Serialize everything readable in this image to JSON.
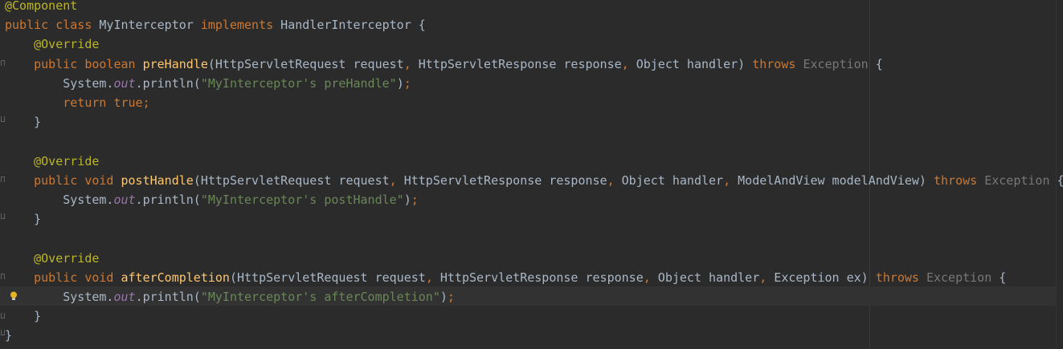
{
  "editor": {
    "colors": {
      "background": "#2b2b2b",
      "keyword": "#cc7832",
      "annotation": "#bbb529",
      "method": "#ffc66d",
      "string": "#6a8759",
      "static_field": "#9876aa",
      "plain": "#a9b7c6",
      "dim": "#787878"
    },
    "gutter_icons": [
      "fold-icon",
      "lightbulb-icon"
    ],
    "lines": [
      {
        "tokens": [
          {
            "t": "@Component",
            "c": "ann"
          }
        ]
      },
      {
        "tokens": [
          {
            "t": "public",
            "c": "kw"
          },
          {
            "t": " ",
            "c": "pl"
          },
          {
            "t": "class",
            "c": "kw"
          },
          {
            "t": " MyInterceptor ",
            "c": "pl"
          },
          {
            "t": "implements",
            "c": "kw"
          },
          {
            "t": " HandlerInterceptor {",
            "c": "pl"
          }
        ]
      },
      {
        "tokens": [
          {
            "t": "    ",
            "c": "pl"
          },
          {
            "t": "@Override",
            "c": "ann"
          }
        ]
      },
      {
        "tokens": [
          {
            "t": "    ",
            "c": "pl"
          },
          {
            "t": "public",
            "c": "kw"
          },
          {
            "t": " ",
            "c": "pl"
          },
          {
            "t": "boolean",
            "c": "kw"
          },
          {
            "t": " ",
            "c": "pl"
          },
          {
            "t": "preHandle",
            "c": "fn"
          },
          {
            "t": "(HttpServletRequest request",
            "c": "pl"
          },
          {
            "t": ",",
            "c": "kw"
          },
          {
            "t": " HttpServletResponse response",
            "c": "pl"
          },
          {
            "t": ",",
            "c": "kw"
          },
          {
            "t": " Object handler) ",
            "c": "pl"
          },
          {
            "t": "throws",
            "c": "kw"
          },
          {
            "t": " ",
            "c": "pl"
          },
          {
            "t": "Exception",
            "c": "exc"
          },
          {
            "t": " {",
            "c": "pl"
          }
        ]
      },
      {
        "tokens": [
          {
            "t": "        System.",
            "c": "pl"
          },
          {
            "t": "out",
            "c": "ital"
          },
          {
            "t": ".println(",
            "c": "pl"
          },
          {
            "t": "\"MyInterceptor's preHandle\"",
            "c": "str"
          },
          {
            "t": ")",
            "c": "pl"
          },
          {
            "t": ";",
            "c": "kw"
          }
        ]
      },
      {
        "tokens": [
          {
            "t": "        ",
            "c": "pl"
          },
          {
            "t": "return",
            "c": "kw"
          },
          {
            "t": " ",
            "c": "pl"
          },
          {
            "t": "true",
            "c": "kw"
          },
          {
            "t": ";",
            "c": "kw"
          }
        ]
      },
      {
        "tokens": [
          {
            "t": "    }",
            "c": "pl"
          }
        ]
      },
      {
        "tokens": []
      },
      {
        "tokens": [
          {
            "t": "    ",
            "c": "pl"
          },
          {
            "t": "@Override",
            "c": "ann"
          }
        ]
      },
      {
        "tokens": [
          {
            "t": "    ",
            "c": "pl"
          },
          {
            "t": "public",
            "c": "kw"
          },
          {
            "t": " ",
            "c": "pl"
          },
          {
            "t": "void",
            "c": "kw"
          },
          {
            "t": " ",
            "c": "pl"
          },
          {
            "t": "postHandle",
            "c": "fn"
          },
          {
            "t": "(HttpServletRequest request",
            "c": "pl"
          },
          {
            "t": ",",
            "c": "kw"
          },
          {
            "t": " HttpServletResponse response",
            "c": "pl"
          },
          {
            "t": ",",
            "c": "kw"
          },
          {
            "t": " Object handler",
            "c": "pl"
          },
          {
            "t": ",",
            "c": "kw"
          },
          {
            "t": " ModelAndView modelAndView) ",
            "c": "pl"
          },
          {
            "t": "throws",
            "c": "kw"
          },
          {
            "t": " ",
            "c": "pl"
          },
          {
            "t": "Exception",
            "c": "exc"
          },
          {
            "t": " {",
            "c": "pl"
          }
        ]
      },
      {
        "tokens": [
          {
            "t": "        System.",
            "c": "pl"
          },
          {
            "t": "out",
            "c": "ital"
          },
          {
            "t": ".println(",
            "c": "pl"
          },
          {
            "t": "\"MyInterceptor's postHandle\"",
            "c": "str"
          },
          {
            "t": ")",
            "c": "pl"
          },
          {
            "t": ";",
            "c": "kw"
          }
        ]
      },
      {
        "tokens": [
          {
            "t": "    }",
            "c": "pl"
          }
        ]
      },
      {
        "tokens": []
      },
      {
        "tokens": [
          {
            "t": "    ",
            "c": "pl"
          },
          {
            "t": "@Override",
            "c": "ann"
          }
        ]
      },
      {
        "tokens": [
          {
            "t": "    ",
            "c": "pl"
          },
          {
            "t": "public",
            "c": "kw"
          },
          {
            "t": " ",
            "c": "pl"
          },
          {
            "t": "void",
            "c": "kw"
          },
          {
            "t": " ",
            "c": "pl"
          },
          {
            "t": "afterCompletion",
            "c": "fn"
          },
          {
            "t": "(HttpServletRequest request",
            "c": "pl"
          },
          {
            "t": ",",
            "c": "kw"
          },
          {
            "t": " HttpServletResponse response",
            "c": "pl"
          },
          {
            "t": ",",
            "c": "kw"
          },
          {
            "t": " Object handler",
            "c": "pl"
          },
          {
            "t": ",",
            "c": "kw"
          },
          {
            "t": " Exception ex) ",
            "c": "pl"
          },
          {
            "t": "throws",
            "c": "kw"
          },
          {
            "t": " ",
            "c": "pl"
          },
          {
            "t": "Exception",
            "c": "exc"
          },
          {
            "t": " {",
            "c": "pl"
          }
        ]
      },
      {
        "tokens": [
          {
            "t": "        System.",
            "c": "pl"
          },
          {
            "t": "out",
            "c": "ital"
          },
          {
            "t": ".println(",
            "c": "pl"
          },
          {
            "t": "\"MyInterceptor's afterCompletion\"",
            "c": "str"
          },
          {
            "t": ")",
            "c": "pl"
          },
          {
            "t": ";",
            "c": "kw"
          }
        ]
      },
      {
        "tokens": [
          {
            "t": "    }",
            "c": "pl"
          }
        ]
      },
      {
        "tokens": [
          {
            "t": "}",
            "c": "pl"
          }
        ]
      }
    ]
  }
}
